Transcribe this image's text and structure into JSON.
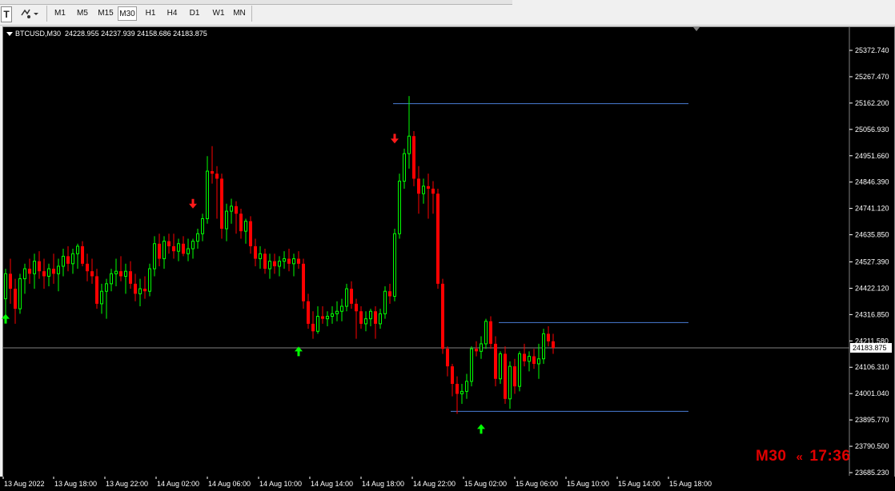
{
  "toolbar": {
    "text_tool_icon": "T",
    "shapes_tool_icon": "shapes-dropdown",
    "timeframes": [
      "M1",
      "M5",
      "M15",
      "M30",
      "H1",
      "H4",
      "D1",
      "W1",
      "MN"
    ],
    "active_timeframe": "M30"
  },
  "chart_info": {
    "symbol_period": "BTCUSD,M30",
    "ohlc": "24228.955 24237.939 24158.686 24183.875"
  },
  "timer": {
    "period": "M30",
    "arrows": "«",
    "countdown": "17:36"
  },
  "colors": {
    "background": "#000000",
    "bull": "#00ff00",
    "bear": "#ff0000",
    "level_line": "#4a7dd6",
    "bid_line": "#808080",
    "axis_text": "#ffffff",
    "timer": "#e00000"
  },
  "chart_data": {
    "type": "candlestick",
    "symbol": "BTCUSD",
    "timeframe": "M30",
    "ylim": [
      23660,
      25430
    ],
    "y_tick_labels": [
      "25372.740",
      "25267.470",
      "25162.200",
      "25056.930",
      "24951.660",
      "24846.390",
      "24741.120",
      "24635.850",
      "24527.390",
      "24422.120",
      "24316.850",
      "24211.580",
      "24106.310",
      "24001.040",
      "23895.770",
      "23790.500",
      "23685.230"
    ],
    "x_tick_labels": [
      "13 Aug 2022",
      "13 Aug 18:00",
      "13 Aug 22:00",
      "14 Aug 02:00",
      "14 Aug 06:00",
      "14 Aug 10:00",
      "14 Aug 14:00",
      "14 Aug 18:00",
      "14 Aug 22:00",
      "15 Aug 02:00",
      "15 Aug 06:00",
      "15 Aug 10:00",
      "15 Aug 14:00",
      "15 Aug 18:00"
    ],
    "current_price": "24183.875",
    "candles": [
      [
        24380,
        24500,
        24300,
        24480
      ],
      [
        24480,
        24540,
        24360,
        24420
      ],
      [
        24420,
        24460,
        24280,
        24340
      ],
      [
        24340,
        24480,
        24320,
        24460
      ],
      [
        24460,
        24520,
        24400,
        24500
      ],
      [
        24500,
        24540,
        24440,
        24480
      ],
      [
        24480,
        24560,
        24420,
        24530
      ],
      [
        24530,
        24570,
        24460,
        24490
      ],
      [
        24490,
        24540,
        24420,
        24470
      ],
      [
        24470,
        24520,
        24430,
        24500
      ],
      [
        24500,
        24560,
        24440,
        24480
      ],
      [
        24480,
        24540,
        24410,
        24510
      ],
      [
        24510,
        24580,
        24470,
        24550
      ],
      [
        24550,
        24590,
        24490,
        24520
      ],
      [
        24520,
        24580,
        24480,
        24560
      ],
      [
        24560,
        24600,
        24500,
        24590
      ],
      [
        24590,
        24610,
        24510,
        24520
      ],
      [
        24520,
        24560,
        24450,
        24490
      ],
      [
        24490,
        24540,
        24440,
        24470
      ],
      [
        24470,
        24500,
        24340,
        24360
      ],
      [
        24360,
        24440,
        24320,
        24410
      ],
      [
        24410,
        24460,
        24300,
        24440
      ],
      [
        24440,
        24500,
        24410,
        24480
      ],
      [
        24480,
        24540,
        24430,
        24490
      ],
      [
        24490,
        24550,
        24450,
        24470
      ],
      [
        24470,
        24520,
        24400,
        24490
      ],
      [
        24490,
        24530,
        24420,
        24440
      ],
      [
        24440,
        24480,
        24370,
        24400
      ],
      [
        24400,
        24460,
        24350,
        24420
      ],
      [
        24420,
        24470,
        24380,
        24410
      ],
      [
        24410,
        24520,
        24390,
        24500
      ],
      [
        24500,
        24630,
        24470,
        24600
      ],
      [
        24600,
        24640,
        24510,
        24540
      ],
      [
        24540,
        24630,
        24500,
        24610
      ],
      [
        24610,
        24640,
        24560,
        24590
      ],
      [
        24590,
        24640,
        24540,
        24570
      ],
      [
        24570,
        24620,
        24530,
        24600
      ],
      [
        24600,
        24630,
        24550,
        24560
      ],
      [
        24560,
        24620,
        24530,
        24580
      ],
      [
        24580,
        24620,
        24540,
        24610
      ],
      [
        24610,
        24660,
        24580,
        24640
      ],
      [
        24640,
        24720,
        24610,
        24700
      ],
      [
        24700,
        24950,
        24680,
        24890
      ],
      [
        24890,
        24990,
        24840,
        24880
      ],
      [
        24880,
        24910,
        24700,
        24860
      ],
      [
        24860,
        24880,
        24620,
        24660
      ],
      [
        24660,
        24760,
        24610,
        24730
      ],
      [
        24730,
        24780,
        24680,
        24750
      ],
      [
        24750,
        24770,
        24640,
        24720
      ],
      [
        24720,
        24740,
        24620,
        24650
      ],
      [
        24650,
        24700,
        24600,
        24690
      ],
      [
        24690,
        24710,
        24560,
        24590
      ],
      [
        24590,
        24620,
        24510,
        24540
      ],
      [
        24540,
        24590,
        24500,
        24560
      ],
      [
        24560,
        24580,
        24480,
        24500
      ],
      [
        24500,
        24560,
        24460,
        24530
      ],
      [
        24530,
        24560,
        24480,
        24510
      ],
      [
        24510,
        24550,
        24470,
        24530
      ],
      [
        24530,
        24570,
        24500,
        24540
      ],
      [
        24540,
        24580,
        24490,
        24520
      ],
      [
        24520,
        24560,
        24470,
        24540
      ],
      [
        24540,
        24570,
        24500,
        24520
      ],
      [
        24520,
        24540,
        24340,
        24370
      ],
      [
        24370,
        24400,
        24260,
        24280
      ],
      [
        24280,
        24330,
        24220,
        24250
      ],
      [
        24250,
        24350,
        24240,
        24310
      ],
      [
        24310,
        24350,
        24280,
        24300
      ],
      [
        24300,
        24330,
        24270,
        24310
      ],
      [
        24310,
        24350,
        24280,
        24320
      ],
      [
        24320,
        24370,
        24290,
        24330
      ],
      [
        24330,
        24380,
        24290,
        24350
      ],
      [
        24350,
        24440,
        24330,
        24420
      ],
      [
        24420,
        24450,
        24340,
        24360
      ],
      [
        24360,
        24380,
        24220,
        24330
      ],
      [
        24330,
        24350,
        24260,
        24280
      ],
      [
        24280,
        24330,
        24250,
        24300
      ],
      [
        24300,
        24340,
        24270,
        24330
      ],
      [
        24330,
        24350,
        24220,
        24280
      ],
      [
        24280,
        24340,
        24260,
        24320
      ],
      [
        24320,
        24430,
        24300,
        24410
      ],
      [
        24410,
        24440,
        24360,
        24390
      ],
      [
        24390,
        24660,
        24370,
        24640
      ],
      [
        24640,
        24880,
        24620,
        24850
      ],
      [
        24850,
        24980,
        24820,
        24960
      ],
      [
        24960,
        25190,
        24900,
        25030
      ],
      [
        25030,
        25050,
        24830,
        24860
      ],
      [
        24860,
        24910,
        24720,
        24800
      ],
      [
        24800,
        24860,
        24760,
        24830
      ],
      [
        24830,
        24880,
        24700,
        24820
      ],
      [
        24820,
        24850,
        24720,
        24800
      ],
      [
        24800,
        24820,
        24420,
        24440
      ],
      [
        24440,
        24460,
        24160,
        24180
      ],
      [
        24180,
        24190,
        24070,
        24110
      ],
      [
        24110,
        24120,
        23990,
        24040
      ],
      [
        24040,
        24070,
        23920,
        24000
      ],
      [
        24000,
        24040,
        23960,
        24010
      ],
      [
        24010,
        24080,
        23980,
        24050
      ],
      [
        24050,
        24190,
        24030,
        24180
      ],
      [
        24180,
        24210,
        24150,
        24170
      ],
      [
        24170,
        24230,
        24140,
        24200
      ],
      [
        24200,
        24300,
        24180,
        24290
      ],
      [
        24290,
        24310,
        24180,
        24200
      ],
      [
        24200,
        24230,
        24030,
        24060
      ],
      [
        24060,
        24170,
        24040,
        24160
      ],
      [
        24160,
        24190,
        23960,
        23980
      ],
      [
        23980,
        24130,
        23940,
        24110
      ],
      [
        24110,
        24140,
        24000,
        24030
      ],
      [
        24030,
        24170,
        24010,
        24160
      ],
      [
        24160,
        24200,
        24110,
        24130
      ],
      [
        24130,
        24170,
        24090,
        24150
      ],
      [
        24150,
        24180,
        24100,
        24120
      ],
      [
        24120,
        24200,
        24060,
        24140
      ],
      [
        24140,
        24260,
        24120,
        24240
      ],
      [
        24240,
        24270,
        24190,
        24210
      ],
      [
        24210,
        24240,
        24160,
        24183.875
      ]
    ],
    "horizontal_lines": [
      {
        "name": "high-level-line",
        "price": 25160
      },
      {
        "name": "upper-range-line",
        "price": 24285
      },
      {
        "name": "lower-range-line",
        "price": 23930
      },
      {
        "name": "bid-price-line",
        "price": 24183.875
      }
    ],
    "signal_arrows": [
      {
        "type": "buy",
        "candle": 0,
        "price": 24300
      },
      {
        "type": "sell",
        "candle": 39,
        "price": 24760
      },
      {
        "type": "buy",
        "candle": 61,
        "price": 24170
      },
      {
        "type": "sell",
        "candle": 81,
        "price": 25020
      },
      {
        "type": "buy",
        "candle": 99,
        "price": 23860
      }
    ],
    "grid": false
  }
}
